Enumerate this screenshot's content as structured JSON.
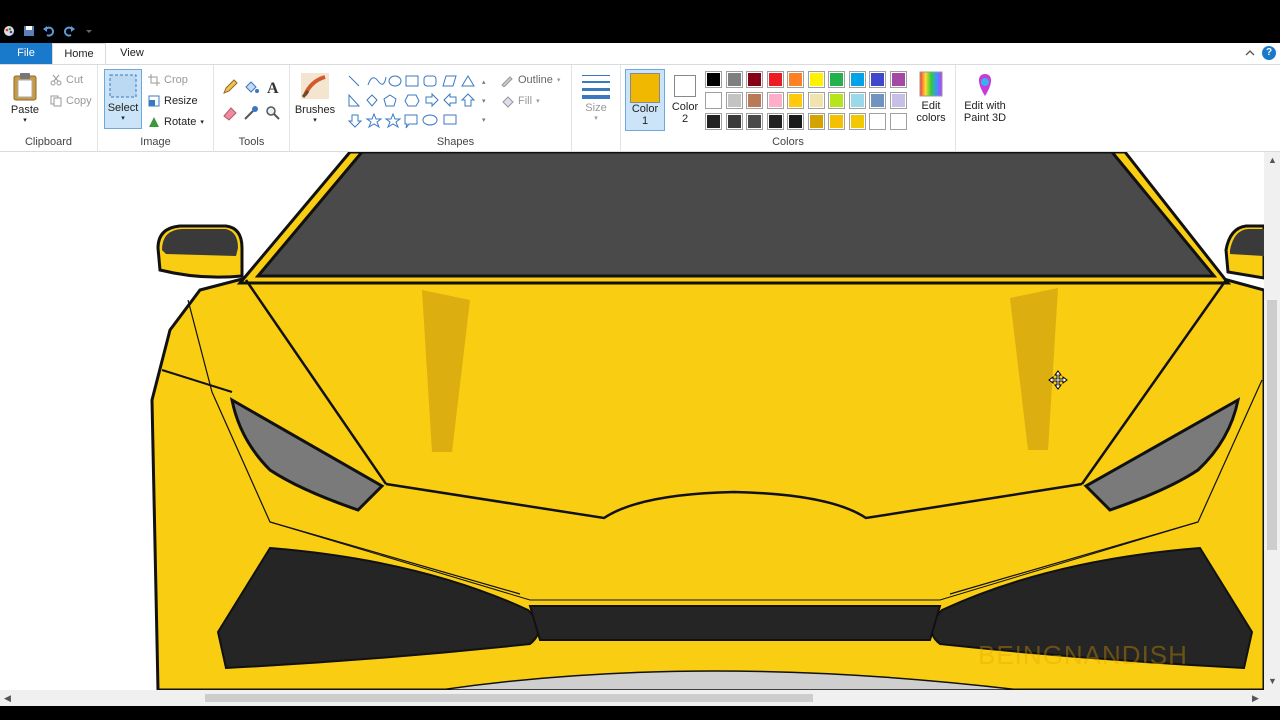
{
  "tabs": {
    "file": "File",
    "home": "Home",
    "view": "View"
  },
  "help_label": "?",
  "clipboard": {
    "paste": "Paste",
    "cut": "Cut",
    "copy": "Copy",
    "label": "Clipboard"
  },
  "image": {
    "select": "Select",
    "crop": "Crop",
    "resize": "Resize",
    "rotate": "Rotate",
    "label": "Image"
  },
  "tools": {
    "label": "Tools"
  },
  "brushes": {
    "label": "Brushes"
  },
  "shapes": {
    "outline": "Outline",
    "fill": "Fill",
    "label": "Shapes"
  },
  "size": {
    "label": "Size"
  },
  "colors": {
    "color1_label": "Color",
    "color1_num": "1",
    "color2_label": "Color",
    "color2_num": "2",
    "color1_value": "#f0b800",
    "color2_value": "#ffffff",
    "edit_label_1": "Edit",
    "edit_label_2": "colors",
    "label": "Colors",
    "palette_row1": [
      "#000000",
      "#7f7f7f",
      "#880015",
      "#ed1c24",
      "#ff7f27",
      "#fff200",
      "#22b14c",
      "#00a2e8",
      "#3f48cc",
      "#a349a4"
    ],
    "palette_row2": [
      "#ffffff",
      "#c3c3c3",
      "#b97a57",
      "#ffaec9",
      "#ffc90e",
      "#efe4b0",
      "#b5e61d",
      "#99d9ea",
      "#7092be",
      "#c8bfe7"
    ],
    "palette_row3": [
      "#222222",
      "#3a3a3a",
      "#4a4a4a",
      "#222222",
      "#1a1a1a",
      "#d4a300",
      "#f5c000",
      "#f2c800",
      "#ffffff",
      "#ffffff"
    ]
  },
  "paint3d": {
    "line1": "Edit with",
    "line2": "Paint 3D"
  },
  "canvas": {
    "body_color": "#f8cd12",
    "glass_color": "#4a4a4a",
    "lamp_color": "#7a7a7a",
    "intake_color": "#252525",
    "shade_color": "#dcae10",
    "watermark": "BEINGNANDISH"
  }
}
